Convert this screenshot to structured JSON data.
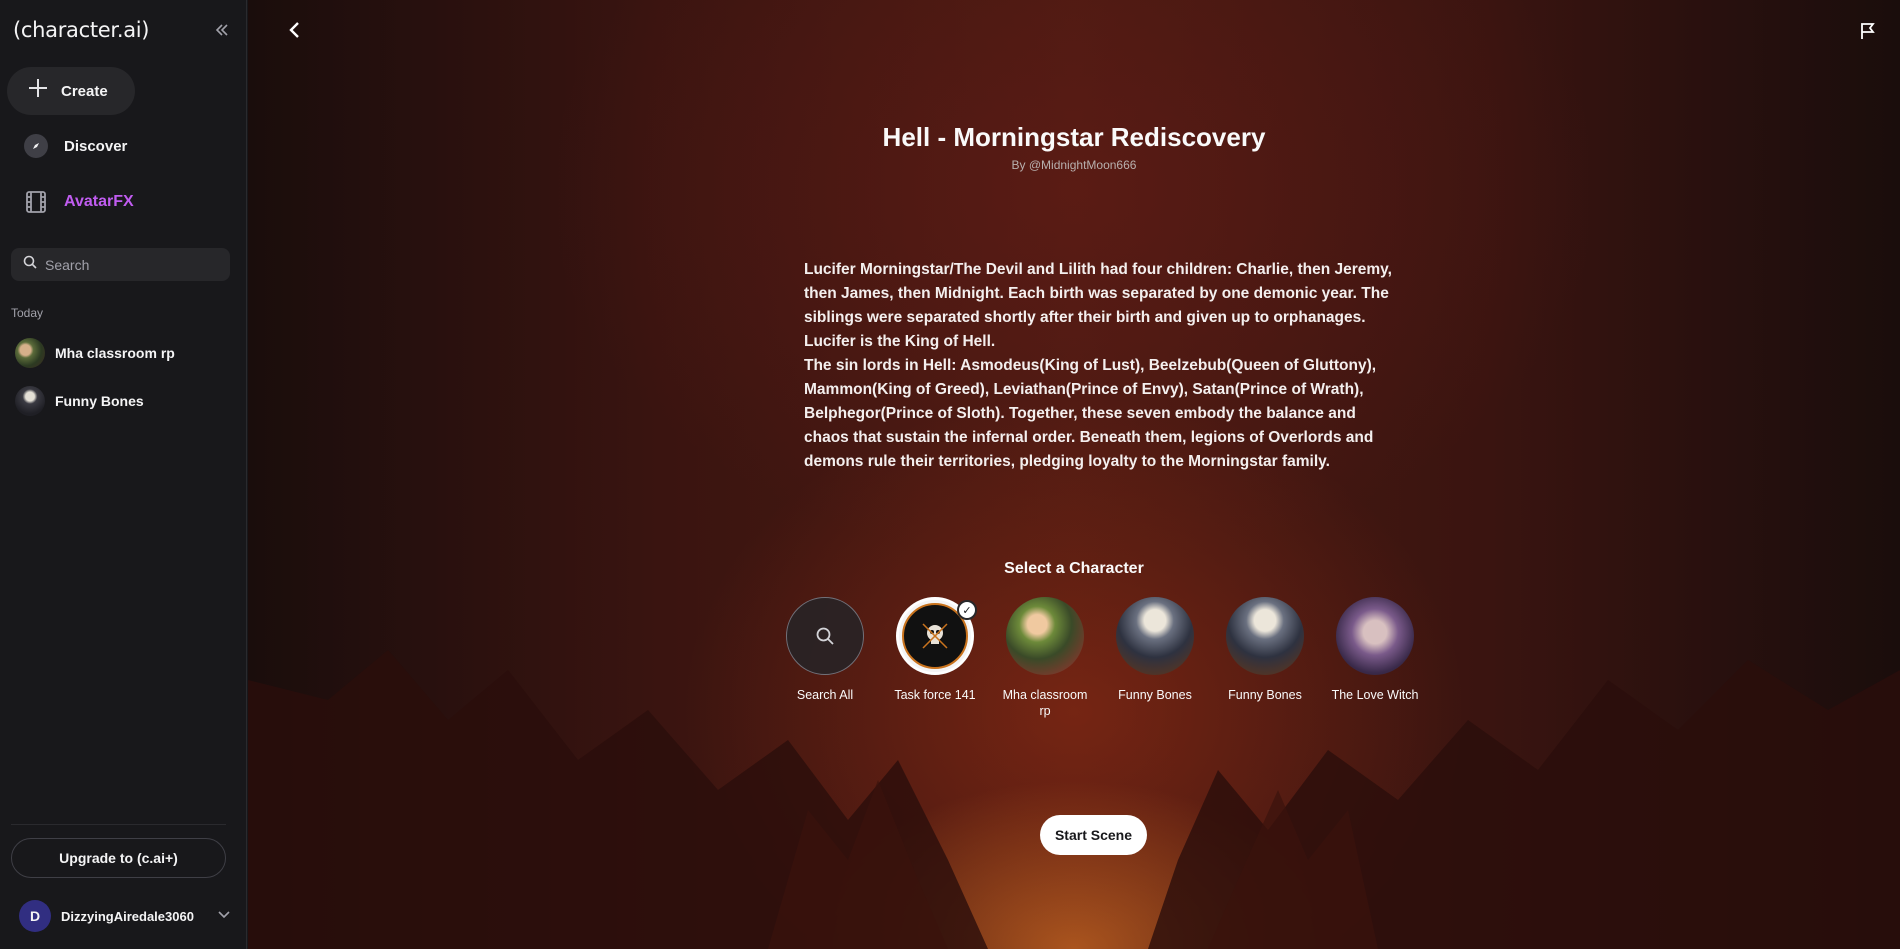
{
  "app": {
    "logo": "(character.ai)"
  },
  "sidebar": {
    "create_label": "Create",
    "discover_label": "Discover",
    "avatarfx_label": "AvatarFX",
    "search_placeholder": "Search",
    "section_today": "Today",
    "recent": [
      {
        "label": "Mha classroom rp",
        "icon": "mha-avatar"
      },
      {
        "label": "Funny Bones",
        "icon": "skeleton-avatar"
      }
    ],
    "upgrade_label": "Upgrade to (c.ai+)",
    "user": {
      "initial": "D",
      "name": "DizzyingAiredale3060"
    }
  },
  "scene": {
    "title": "Hell - Morningstar Rediscovery",
    "byline": "By @MidnightMoon666",
    "description_p1": "Lucifer Morningstar/The Devil and Lilith had four children: Charlie, then Jeremy, then James, then Midnight. Each birth was separated by one demonic year. The siblings were separated shortly after their birth and given up to orphanages. Lucifer is the King of Hell.",
    "description_p2": "The sin lords in Hell: Asmodeus(King of Lust), Beelzebub(Queen of Gluttony), Mammon(King of Greed), Leviathan(Prince of Envy), Satan(Prince of Wrath), Belphegor(Prince of Sloth). Together, these seven embody the balance and chaos that sustain the infernal order. Beneath them, legions of Overlords and demons rule their territories, pledging loyalty to the Morningstar family.",
    "select_label": "Select a Character",
    "characters": [
      {
        "name": "Search All"
      },
      {
        "name": "Task force 141",
        "selected": true
      },
      {
        "name": "Mha classroom rp"
      },
      {
        "name": "Funny Bones"
      },
      {
        "name": "Funny Bones"
      },
      {
        "name": "The Love Witch"
      }
    ],
    "start_label": "Start Scene"
  },
  "colors": {
    "avatarfx_accent": "#c05cf0",
    "sidebar_bg": "#18181b",
    "selected_ring": "#ffffff"
  }
}
